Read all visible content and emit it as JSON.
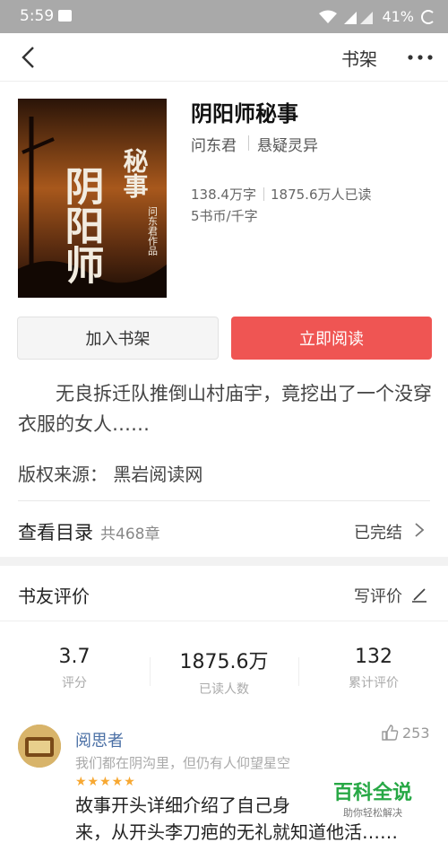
{
  "status_bar": {
    "time": "5:59",
    "battery": "41%"
  },
  "nav": {
    "shelf_label": "书架"
  },
  "book": {
    "title": "阴阳师秘事",
    "author": "问东君",
    "genre": "悬疑灵异",
    "word_count": "138.4万字",
    "readers": "1875.6万人已读",
    "price": "5书币/千字",
    "cover_title_big": "阴阳师",
    "cover_title_small": "秘事",
    "cover_author": "问东君作品"
  },
  "actions": {
    "add_shelf": "加入书架",
    "read_now": "立即阅读"
  },
  "synopsis": "无良拆迁队推倒山村庙宇，竟挖出了一个没穿衣服的女人……",
  "copyright": "版权来源：  黑岩阅读网",
  "toc": {
    "label": "查看目录",
    "count": "共468章",
    "status": "已完结"
  },
  "reviews": {
    "header": "书友评价",
    "write": "写评价",
    "metrics": [
      {
        "value": "3.7",
        "label": "评分"
      },
      {
        "value": "1875.6万",
        "label": "已读人数"
      },
      {
        "value": "132",
        "label": "累计评价"
      }
    ],
    "item": {
      "name": "阅思者",
      "likes": "253",
      "signature": "我们都在阴沟里，但仍有人仰望星空",
      "stars": "★★★★★",
      "text1": "故事开头详细介绍了自己身",
      "text2": "来，从开头李刀疤的无礼就知道他活……"
    }
  },
  "watermark": {
    "line1": "百科全说",
    "line2": "助你轻松解决"
  },
  "colors": {
    "accent": "#ef5553",
    "link": "#4a6fa5",
    "star": "#f7a832",
    "watermark": "#27a845"
  }
}
